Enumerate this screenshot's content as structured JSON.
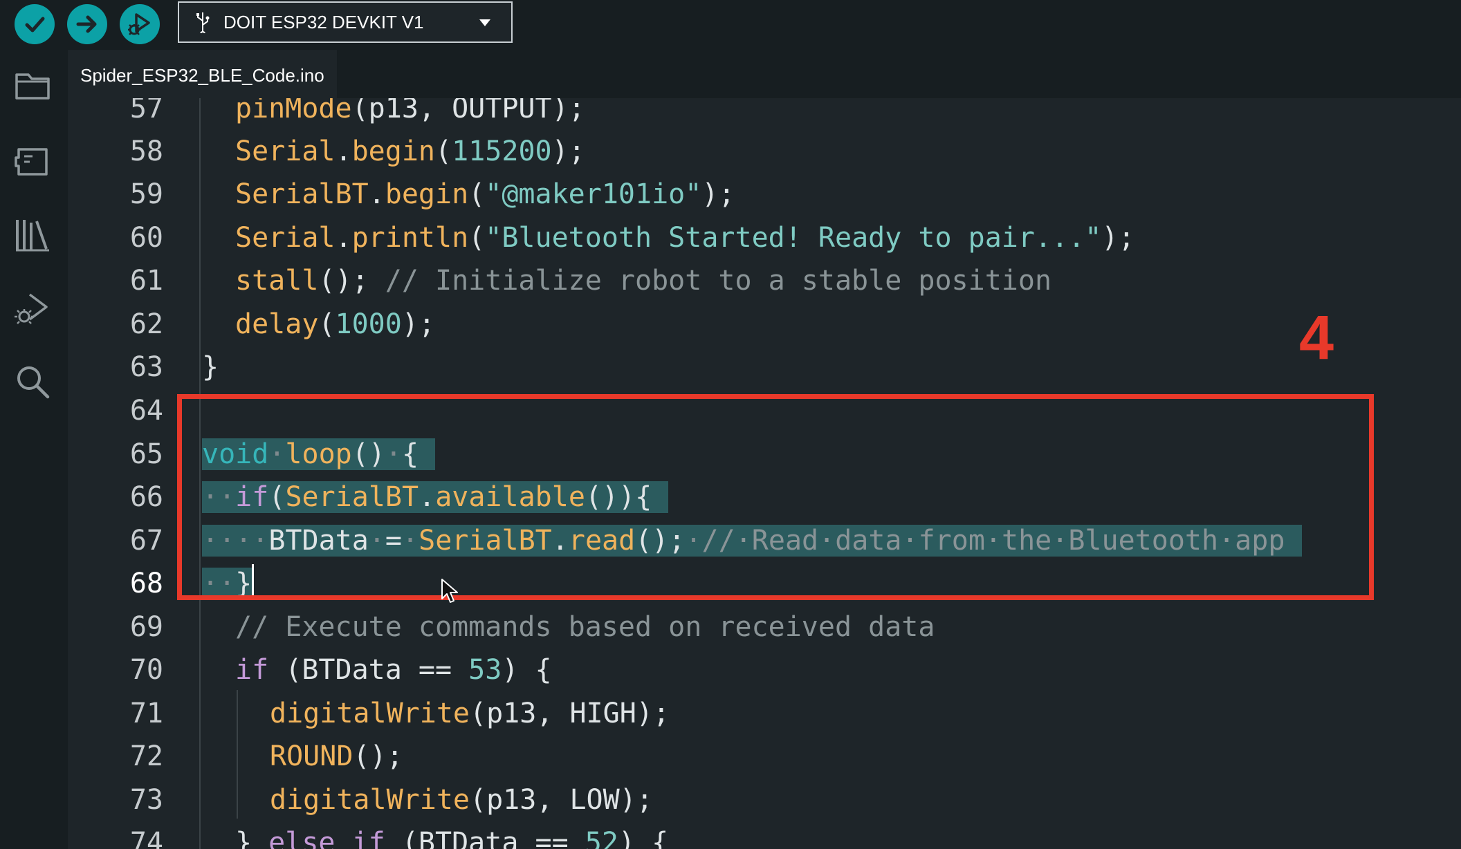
{
  "toolbar": {
    "verify_icon": "checkmark-icon",
    "upload_icon": "arrow-right-icon",
    "debug_icon": "debug-icon",
    "board_name": "DOIT ESP32 DEVKIT V1",
    "accent_color": "#0ca1a6"
  },
  "sidebar": {
    "icons": [
      "folder-icon",
      "board-manager-icon",
      "library-icon",
      "debug-icon",
      "search-icon"
    ]
  },
  "tab": {
    "filename": "Spider_ESP32_BLE_Code.ino"
  },
  "editor": {
    "lines": [
      {
        "num": "57",
        "text": "pinMode(p13, OUTPUT);"
      },
      {
        "num": "58",
        "text": "Serial.begin(115200);"
      },
      {
        "num": "59",
        "text": "SerialBT.begin(\"@maker101io\");"
      },
      {
        "num": "60",
        "text": "Serial.println(\"Bluetooth Started! Ready to pair...\");"
      },
      {
        "num": "61",
        "text": "stall(); // Initialize robot to a stable position"
      },
      {
        "num": "62",
        "text": "delay(1000);"
      },
      {
        "num": "63",
        "text": "}"
      },
      {
        "num": "64",
        "text": ""
      },
      {
        "num": "65",
        "text": "void loop() {"
      },
      {
        "num": "66",
        "text": "  if(SerialBT.available()){"
      },
      {
        "num": "67",
        "text": "    BTData = SerialBT.read(); // Read data from the Bluetooth app"
      },
      {
        "num": "68",
        "text": "  }"
      },
      {
        "num": "69",
        "text": "// Execute commands based on received data"
      },
      {
        "num": "70",
        "text": "if (BTData == 53) {"
      },
      {
        "num": "71",
        "text": "digitalWrite(p13, HIGH);"
      },
      {
        "num": "72",
        "text": "ROUND();"
      },
      {
        "num": "73",
        "text": "digitalWrite(p13, LOW);"
      },
      {
        "num": "74",
        "text": "} else if (BTData == 52) {"
      }
    ]
  },
  "annotation": {
    "label": "4",
    "color": "#e8392a"
  }
}
